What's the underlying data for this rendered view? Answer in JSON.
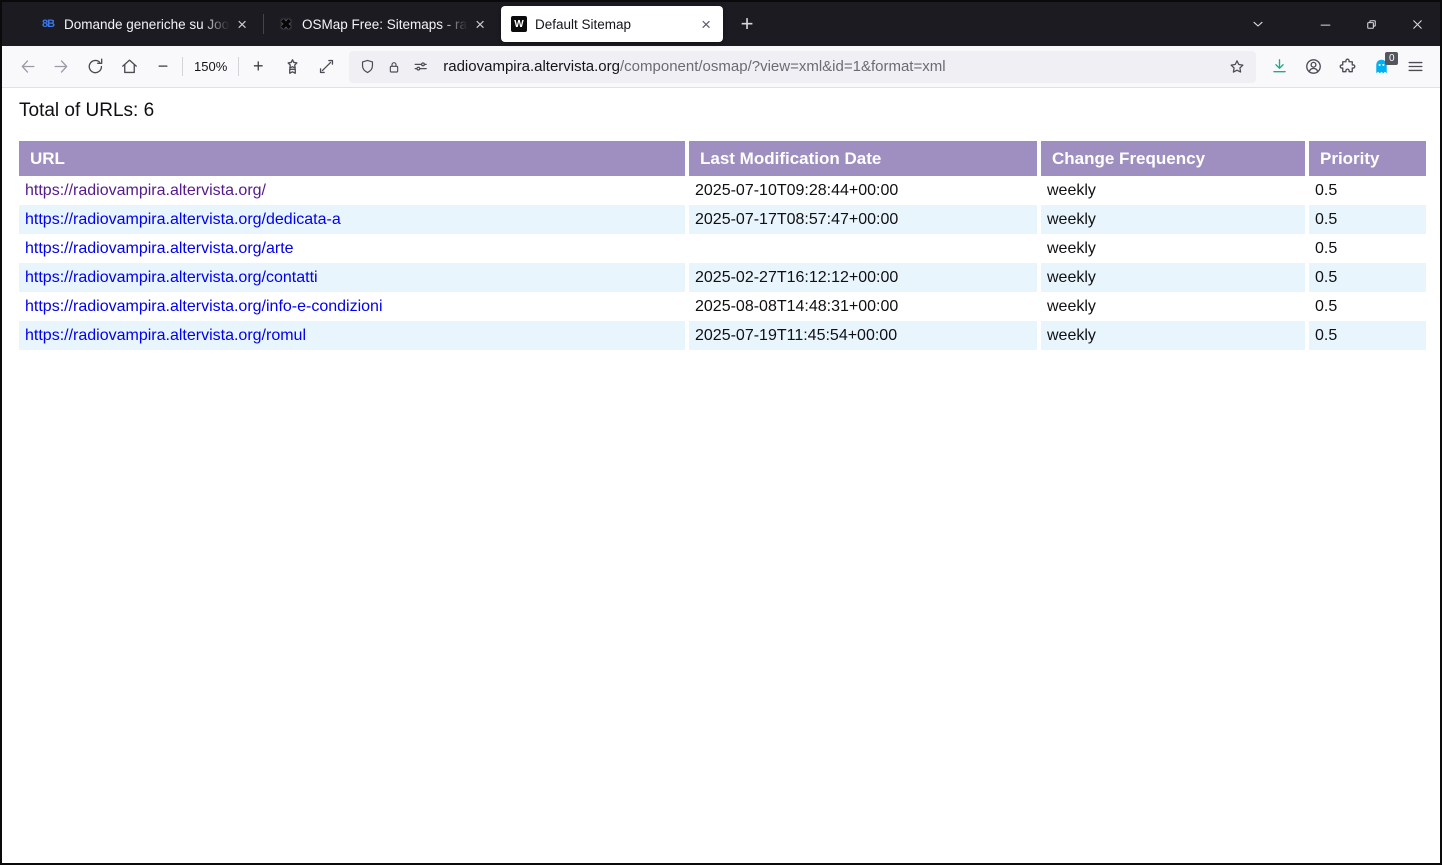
{
  "window": {
    "tabs": [
      {
        "title": "Domande generiche su Joo",
        "favicon": "phpbb-favicon"
      },
      {
        "title": "OSMap Free: Sitemaps - ra",
        "favicon": "joomla-favicon"
      },
      {
        "title": "Default Sitemap",
        "favicon": "site-favicon"
      }
    ]
  },
  "icons": {
    "tab_close": "×",
    "new_tab": "+",
    "zoom_out": "−",
    "zoom_in": "+",
    "phpbb_favicon": "8B",
    "joomla_favicon": "✖",
    "site_favicon": "W"
  },
  "toolbar": {
    "zoom_level": "150%",
    "extension_badge": "0"
  },
  "urlbar": {
    "host": "radiovampira.altervista.org",
    "path": "/component/osmap/?view=xml&id=1&format=xml"
  },
  "page": {
    "total_label": "Total of URLs: 6",
    "table": {
      "headers": [
        "URL",
        "Last Modification Date",
        "Change Frequency",
        "Priority"
      ],
      "rows": [
        {
          "url": "https://radiovampira.altervista.org/",
          "lastmod": "2025-07-10T09:28:44+00:00",
          "changefreq": "weekly",
          "priority": "0.5",
          "visited": true
        },
        {
          "url": "https://radiovampira.altervista.org/dedicata-a",
          "lastmod": "2025-07-17T08:57:47+00:00",
          "changefreq": "weekly",
          "priority": "0.5",
          "visited": false
        },
        {
          "url": "https://radiovampira.altervista.org/arte",
          "lastmod": "",
          "changefreq": "weekly",
          "priority": "0.5",
          "visited": false
        },
        {
          "url": "https://radiovampira.altervista.org/contatti",
          "lastmod": "2025-02-27T16:12:12+00:00",
          "changefreq": "weekly",
          "priority": "0.5",
          "visited": false
        },
        {
          "url": "https://radiovampira.altervista.org/info-e-condizioni",
          "lastmod": "2025-08-08T14:48:31+00:00",
          "changefreq": "weekly",
          "priority": "0.5",
          "visited": false
        },
        {
          "url": "https://radiovampira.altervista.org/romul",
          "lastmod": "2025-07-19T11:45:54+00:00",
          "changefreq": "weekly",
          "priority": "0.5",
          "visited": false
        }
      ]
    }
  },
  "colors": {
    "tabbar_bg": "#1c1b22",
    "active_tab_bg": "#ffffff",
    "toolbar_bg": "#f9f9fb",
    "urlbar_bg": "#f0f0f4",
    "table_header_bg": "#9f8fc1",
    "row_alt_bg": "#e9f5fc",
    "link": "#0000EE",
    "link_visited": "#551A8B",
    "download_icon": "#22a98c",
    "ghost_icon": "#00b0f0"
  }
}
